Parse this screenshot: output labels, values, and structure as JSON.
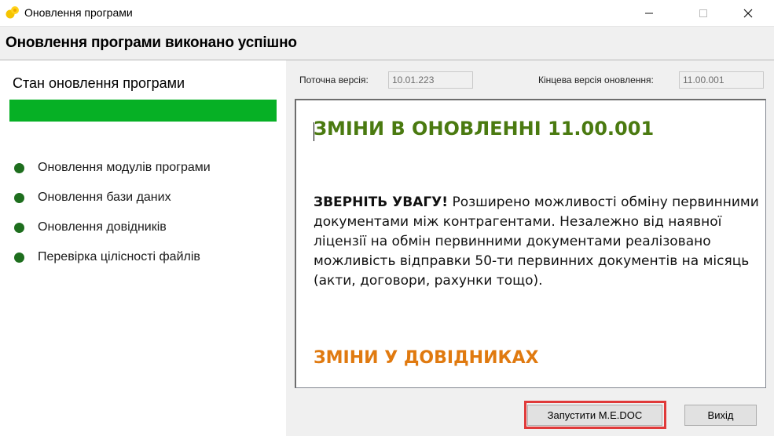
{
  "window": {
    "title": "Оновлення програми",
    "icon": "app-logo-icon"
  },
  "header": {
    "title": "Оновлення програми виконано успішно"
  },
  "status": {
    "title": "Стан оновлення програми",
    "progress_percent": 100,
    "progress_color": "#06b025",
    "steps": [
      {
        "label": "Оновлення модулів програми"
      },
      {
        "label": "Оновлення бази даних"
      },
      {
        "label": "Оновлення довідників"
      },
      {
        "label": "Перевірка цілісності файлів"
      }
    ]
  },
  "versions": {
    "current_label": "Поточна версія:",
    "current_value": "10.01.223",
    "final_label": "Кінцева версія оновлення:",
    "final_value": "11.00.001"
  },
  "content": {
    "heading": "ЗМІНИ В ОНОВЛЕННІ 11.00.001",
    "note_bold": "ЗВЕРНІТЬ УВАГУ!",
    "note_text": " Розширено можливості обміну первинними документами між контрагентами. Незалежно від наявної ліцензії на обмін первинними документами реалізовано можливість відправки 50-ти первинних документів на місяць (акти, договори, рахунки тощо).",
    "subheading": "ЗМІНИ У ДОВІДНИКАХ",
    "heading_color": "#4a7a10",
    "subheading_color": "#e07a10"
  },
  "buttons": {
    "launch": "Запустити M.E.DOC",
    "exit": "Вихід"
  }
}
